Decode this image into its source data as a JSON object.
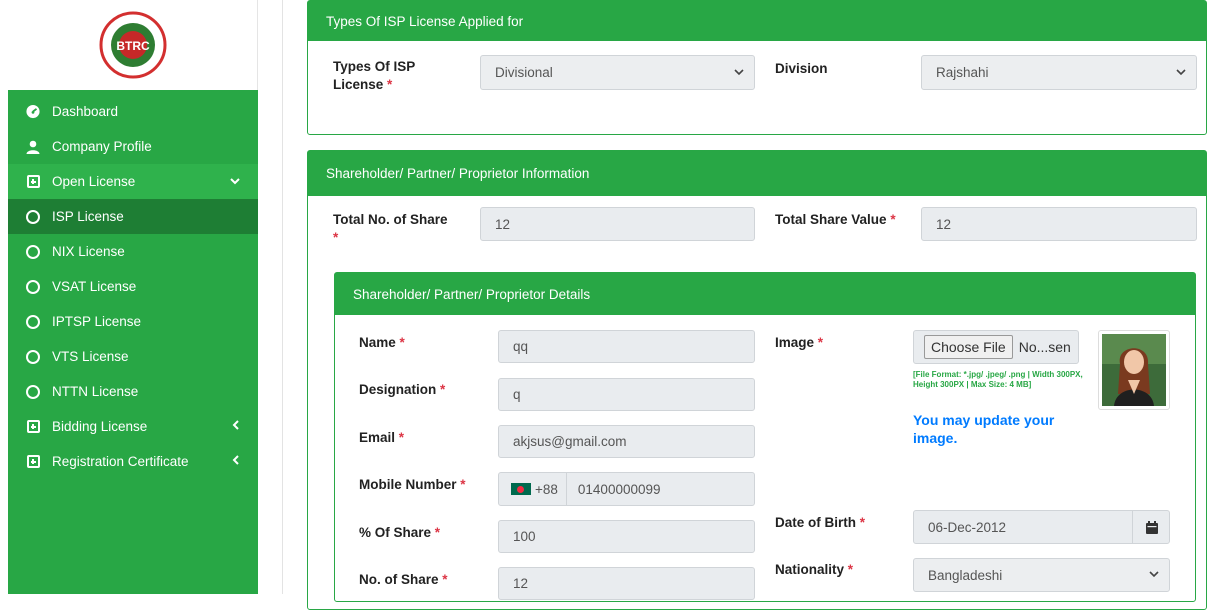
{
  "sidebar": {
    "logo_text": "BTRC",
    "items": [
      {
        "label": "Dashboard",
        "icon": "dashboard-icon"
      },
      {
        "label": "Company Profile",
        "icon": "user-icon"
      },
      {
        "label": "Open License",
        "icon": "plus-square-icon",
        "caret": "⌄"
      },
      {
        "label": "ISP License",
        "icon": "circle-icon"
      },
      {
        "label": "NIX License",
        "icon": "circle-icon"
      },
      {
        "label": "VSAT License",
        "icon": "circle-icon"
      },
      {
        "label": "IPTSP License",
        "icon": "circle-icon"
      },
      {
        "label": "VTS License",
        "icon": "circle-icon"
      },
      {
        "label": "NTTN License",
        "icon": "circle-icon"
      },
      {
        "label": "Bidding License",
        "icon": "plus-square-icon",
        "caret": "‹"
      },
      {
        "label": "Registration Certificate",
        "icon": "plus-square-icon",
        "caret": "‹"
      }
    ]
  },
  "isp_card": {
    "header": "Types Of ISP License Applied for",
    "type_label": "Types Of ISP",
    "type_label_2": "License",
    "type_value": "Divisional",
    "division_label": "Division",
    "division_value": "Rajshahi"
  },
  "share_card": {
    "header": "Shareholder/ Partner/ Proprietor Information",
    "total_no_label": "Total No. of Share",
    "total_no_value": "12",
    "total_value_label": "Total Share Value",
    "total_value_value": "12"
  },
  "details": {
    "header": "Shareholder/ Partner/ Proprietor Details",
    "name_label": "Name",
    "name_value": "qq",
    "designation_label": "Designation",
    "designation_value": "q",
    "email_label": "Email",
    "email_value": "akjsus@gmail.com",
    "mobile_label": "Mobile Number",
    "mobile_code": "+88",
    "mobile_value": "01400000099",
    "share_pct_label": "% Of Share",
    "share_pct_value": "100",
    "no_share_label": "No. of Share",
    "no_share_value": "12",
    "image_label": "Image",
    "choose_file": "Choose File",
    "file_name": "No...sen",
    "file_hint": "[File Format: *.jpg/ .jpeg/ .png | Width 300PX, Height 300PX | Max Size: 4 MB]",
    "update_note": "You may update your image.",
    "dob_label": "Date of Birth",
    "dob_value": "06-Dec-2012",
    "nationality_label": "Nationality",
    "nationality_value": "Bangladeshi"
  },
  "required_mark": "*",
  "colors": {
    "primary": "#28a745",
    "active": "#1e7e34",
    "link": "#007bff",
    "required": "#dc3545"
  }
}
